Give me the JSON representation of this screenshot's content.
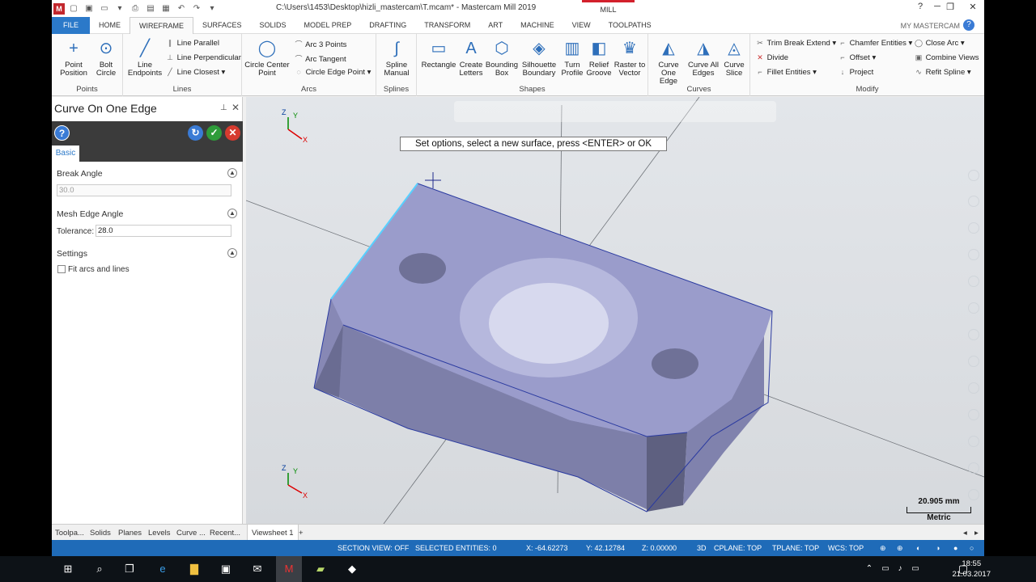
{
  "titlebar": {
    "title": "C:\\Users\\1453\\Desktop\\hizli_mastercam\\T.mcam* - Mastercam Mill 2019",
    "context_tab": "MILL"
  },
  "menu": {
    "items": [
      "FILE",
      "HOME",
      "WIREFRAME",
      "SURFACES",
      "SOLIDS",
      "MODEL PREP",
      "DRAFTING",
      "TRANSFORM",
      "ART",
      "MACHINE",
      "VIEW",
      "TOOLPATHS"
    ],
    "active": "WIREFRAME",
    "account": "MY MASTERCAM"
  },
  "ribbon": {
    "points": {
      "label": "Points",
      "buttons": [
        "Point Position",
        "Bolt Circle"
      ]
    },
    "lines": {
      "label": "Lines",
      "big": "Line Endpoints",
      "small": [
        "Line Parallel",
        "Line Perpendicular",
        "Line Closest"
      ]
    },
    "arcs": {
      "label": "Arcs",
      "big": "Circle Center Point",
      "small": [
        "Arc 3 Points",
        "Arc Tangent",
        "Circle Edge Point"
      ]
    },
    "splines": {
      "label": "Splines",
      "big": "Spline Manual"
    },
    "shapes": {
      "label": "Shapes",
      "buttons": [
        "Rectangle",
        "Create Letters",
        "Bounding Box",
        "Silhouette Boundary",
        "Turn Profile",
        "Relief Groove",
        "Raster to Vector"
      ]
    },
    "curves": {
      "label": "Curves",
      "buttons": [
        "Curve One Edge",
        "Curve All Edges",
        "Curve Slice"
      ]
    },
    "modify": {
      "label": "Modify",
      "small": [
        "Trim Break Extend",
        "Divide",
        "Fillet Entities",
        "Chamfer Entities",
        "Offset",
        "Project",
        "Close Arc",
        "Combine Views",
        "Refit Spline"
      ]
    }
  },
  "panel": {
    "title": "Curve On One Edge",
    "tab": "Basic",
    "break_angle_label": "Break Angle",
    "break_angle_value": "30.0",
    "mesh_label": "Mesh Edge Angle",
    "tolerance_label": "Tolerance:",
    "tolerance_value": "28.0",
    "settings_label": "Settings",
    "fit_label": "Fit arcs and lines"
  },
  "bottom_tabs": {
    "items": [
      "Toolpa...",
      "Solids",
      "Planes",
      "Levels",
      "Curve ...",
      "Recent..."
    ],
    "viewsheet": "Viewsheet 1",
    "add": "+"
  },
  "viewport": {
    "prompt": "Set options, select a new surface, press <ENTER> or OK",
    "scale_value": "20.905 mm",
    "scale_unit": "Metric",
    "axis_x": "X",
    "axis_y": "Y",
    "axis_z": "Z"
  },
  "status": {
    "section_view": "SECTION VIEW: OFF",
    "selected": "SELECTED ENTITIES: 0",
    "x": "X:   -64.62273",
    "y": "Y:   42.12784",
    "z": "Z:   0.00000",
    "mode": "3D",
    "cplane": "CPLANE: TOP",
    "tplane": "TPLANE: TOP",
    "wcs": "WCS: TOP"
  },
  "taskbar": {
    "time": "18:55",
    "date": "21.03.2017"
  },
  "colors": {
    "status": "#1f6bb8",
    "file_tab": "#2b79c9",
    "part": "#9596c6",
    "mill_tab": "#d3202c"
  }
}
